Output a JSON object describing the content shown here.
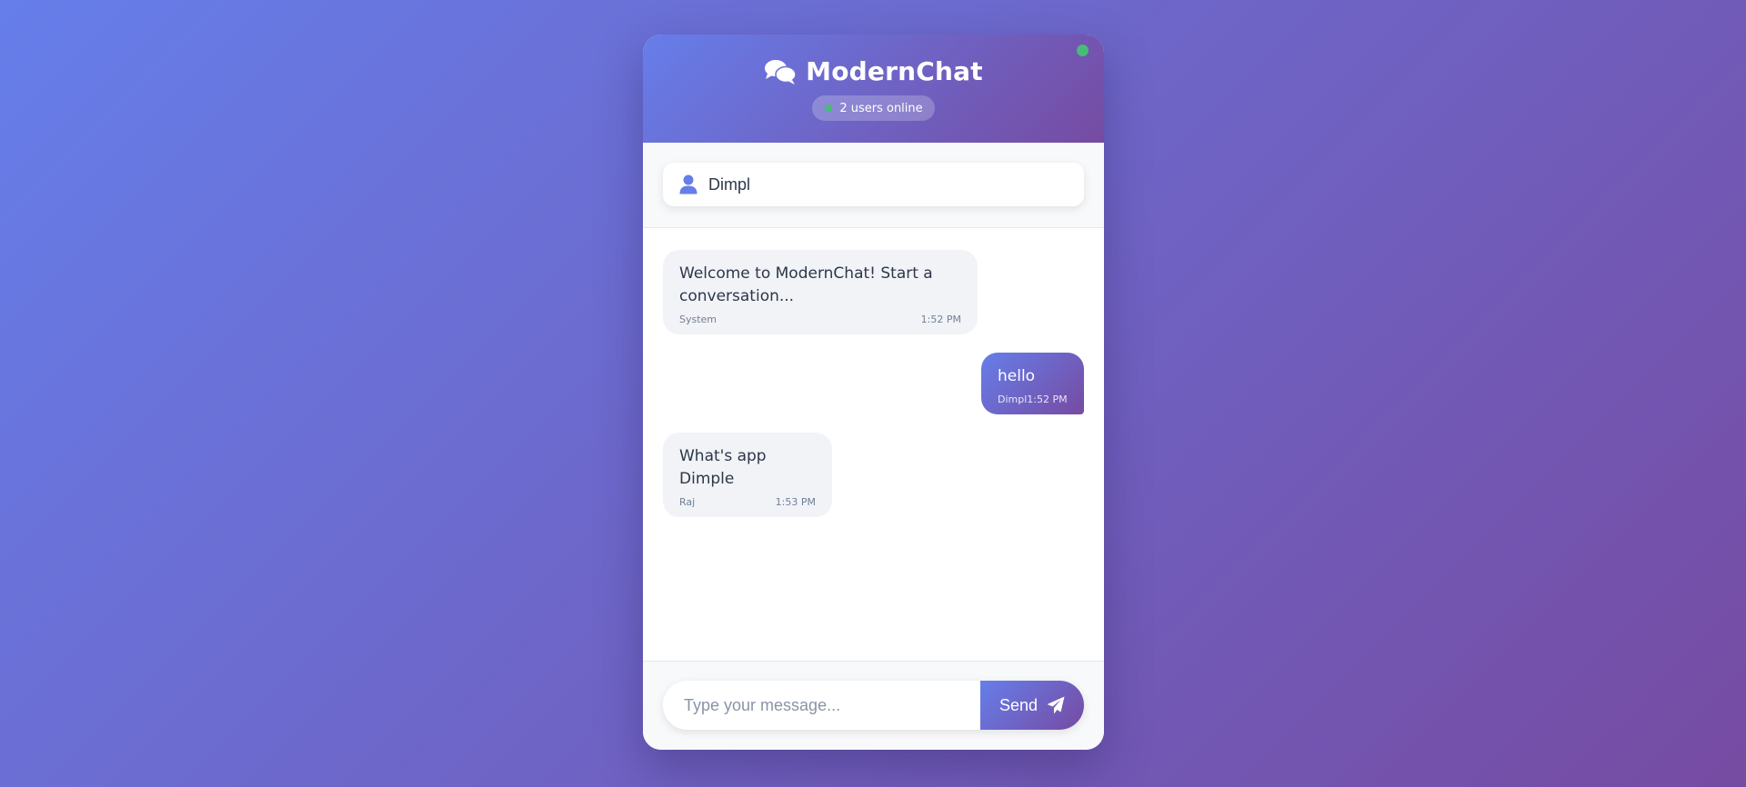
{
  "header": {
    "title": "ModernChat",
    "online_text": "2 users online",
    "icon": "chat-bubbles-icon"
  },
  "username": {
    "value": "Dimpl",
    "icon": "user-icon"
  },
  "messages": [
    {
      "text": "Welcome to ModernChat! Start a conversation...",
      "sender": "System",
      "time": "1:52 PM",
      "own": false
    },
    {
      "text": "hello",
      "sender": "Dimpl",
      "time": "1:52 PM",
      "own": true
    },
    {
      "text": "What's app Dimple",
      "sender": "Raj",
      "time": "1:53 PM",
      "own": false
    }
  ],
  "composer": {
    "placeholder": "Type your message...",
    "send_label": "Send",
    "send_icon": "paper-plane-icon"
  },
  "colors": {
    "gradient_start": "#667eea",
    "gradient_end": "#764ba2",
    "online": "#48bb78"
  }
}
